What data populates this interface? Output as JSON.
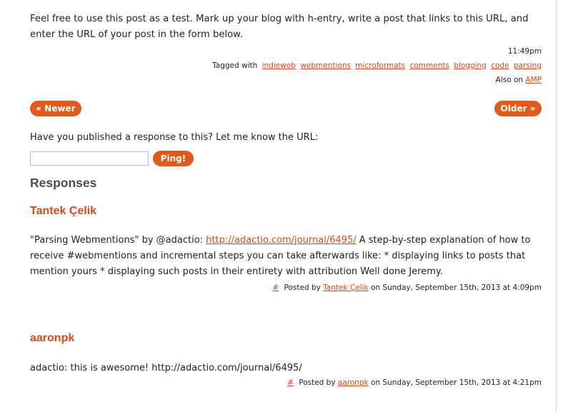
{
  "post": {
    "intro": "Feel free to use this post as a test. Mark up your blog with h-entry, write a post that links to this URL, and enter the URL of your post in the form below.",
    "time": "11:49pm",
    "tagged_label": "Tagged with",
    "tags": [
      "indieweb",
      "webmentions",
      "microformats",
      "comments",
      "blogging",
      "code",
      "parsing"
    ],
    "also_on_label": "Also on",
    "also_on_link": "AMP"
  },
  "nav": {
    "newer_label": "« Newer",
    "older_label": "Older »"
  },
  "form": {
    "prompt": "Have you published a response to this? Let me know the URL:",
    "input_value": "",
    "ping_label": "Ping!"
  },
  "responses": {
    "heading": "Responses",
    "items": [
      {
        "author": "Tantek Çelik",
        "text_before": "\"Parsing Webmentions\" by @adactio: ",
        "link": "http://adactio.com/journal/6495/",
        "text_after": " A step-by-step explanation of how to receive #webmentions and incremental steps you can take afterwards like: * displaying links to posts that mention yours * displaying such posts in their entirety with attribution Well done Jeremy.",
        "permalink": "#",
        "posted_by_label": "Posted by",
        "posted_by": "Tantek Çelik",
        "date_text": "on Sunday, September 15th, 2013 at 4:09pm"
      },
      {
        "author": "aaronpk",
        "text": "adactio: this is awesome! http://adactio.com/journal/6495/",
        "permalink": "#",
        "posted_by_label": "Posted by",
        "posted_by": "aaronpk",
        "date_text": "on Sunday, September 15th, 2013 at 4:21pm"
      }
    ]
  },
  "colors": {
    "accent": "#e05a1e",
    "link": "#d4491c",
    "heading": "#4d4d4d"
  }
}
